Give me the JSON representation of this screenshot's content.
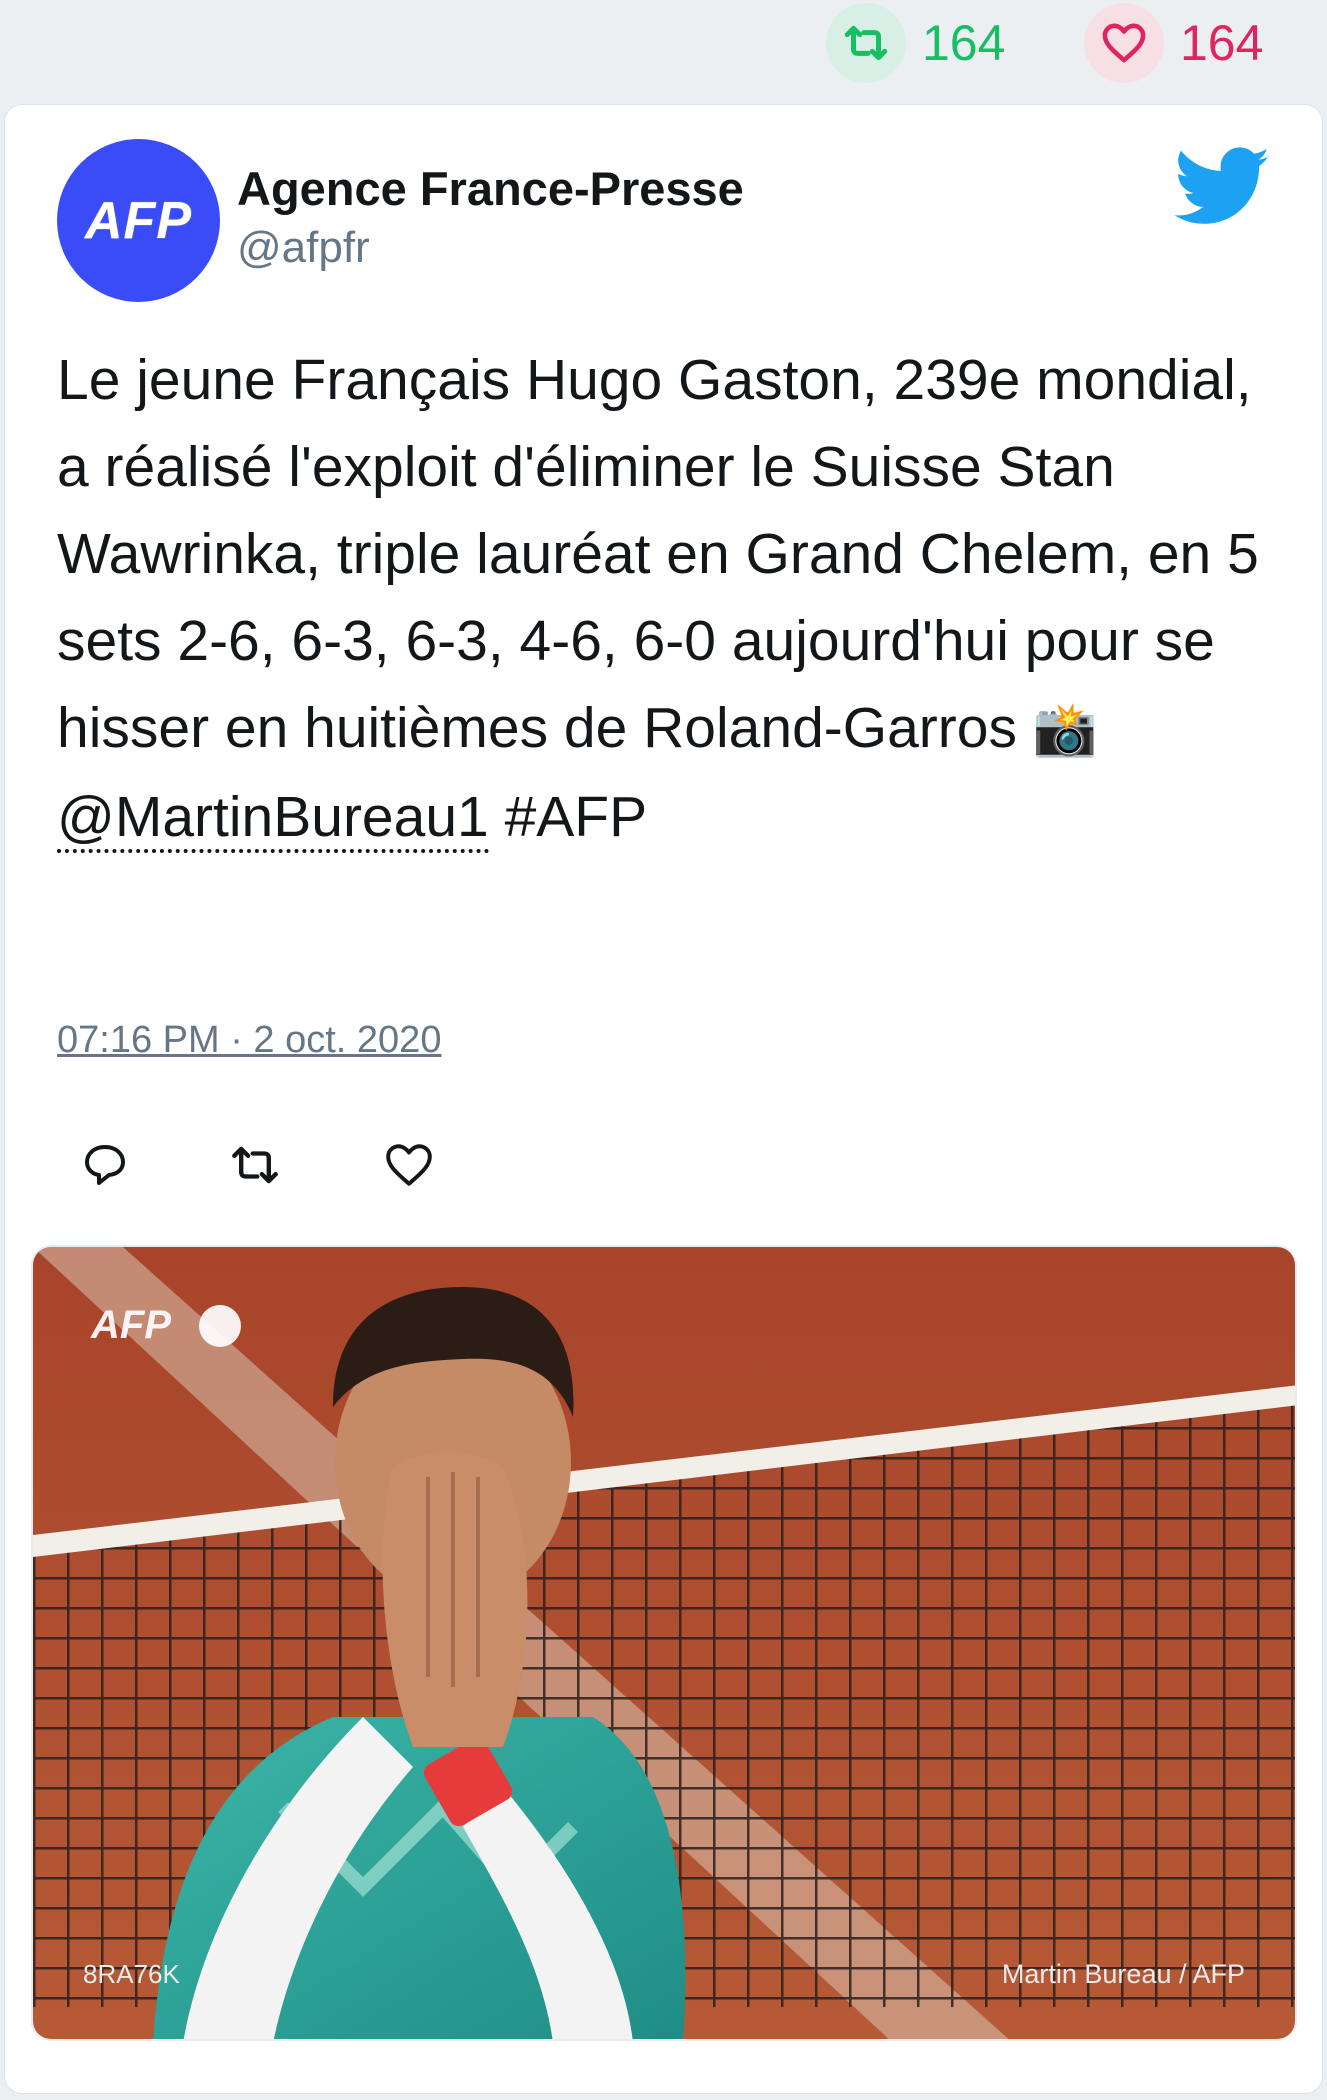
{
  "stats": {
    "retweet_count": "164",
    "like_count": "164",
    "retweet_color": "#17bf63",
    "like_color": "#e0245e"
  },
  "tweet": {
    "author_name": "Agence France-Presse",
    "author_handle": "@afpfr",
    "avatar_text": "AFP",
    "avatar_color": "#3a4cf7",
    "text_main": "Le jeune Français Hugo Gaston, 239e mondial, a réalisé l'exploit d'éliminer le Suisse Stan Wawrinka, triple lauréat en Grand Chelem, en 5 sets 2-6, 6-3, 6-3, 4-6, 6-0 aujourd'hui pour se hisser en huitièmes de Roland-Garros",
    "emoji": "📸",
    "mention": "@MartinBureau1",
    "hashtag": "#AFP",
    "timestamp": "07:16 PM · 2 oct. 2020"
  },
  "icons": {
    "header": [
      "retweet-icon",
      "heart-icon"
    ],
    "brand": "twitter-bird-icon",
    "actions": [
      "reply-icon",
      "retweet-icon",
      "like-icon"
    ]
  },
  "media": {
    "watermark": "AFP",
    "credit_left": "8RA76K",
    "credit_right": "Martin Bureau / AFP"
  }
}
